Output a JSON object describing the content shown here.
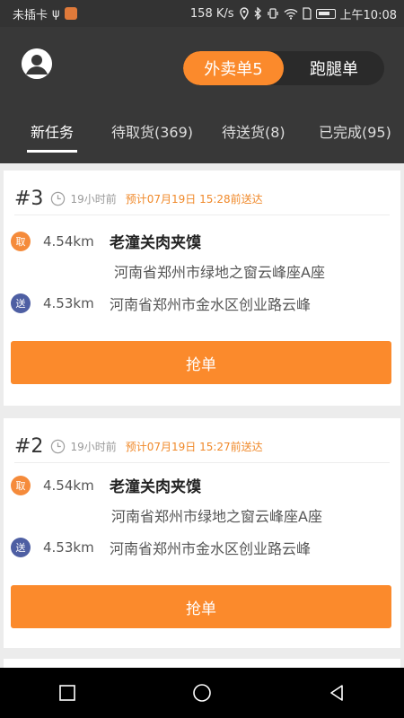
{
  "status_bar": {
    "carrier": "未插卡",
    "usb": "ψ",
    "speed": "158 K/s",
    "time": "上午10:08"
  },
  "header": {
    "segments": [
      {
        "label": "外卖单5",
        "active": true
      },
      {
        "label": "跑腿单",
        "active": false
      }
    ],
    "tabs": [
      {
        "label": "新任务",
        "active": true
      },
      {
        "label": "待取货(369)",
        "active": false
      },
      {
        "label": "待送货(8)",
        "active": false
      },
      {
        "label": "已完成(95)",
        "active": false
      }
    ]
  },
  "orders": [
    {
      "number": "#3",
      "ago": "19小时前",
      "eta": "预计07月19日 15:28前送达",
      "pickup": {
        "badge": "取",
        "distance": "4.54km",
        "shop": "老潼关肉夹馍",
        "address": "河南省郑州市绿地之窗云峰座A座"
      },
      "delivery": {
        "badge": "送",
        "distance": "4.53km",
        "address": "河南省郑州市金水区创业路云峰"
      },
      "button": "抢单"
    },
    {
      "number": "#2",
      "ago": "19小时前",
      "eta": "预计07月19日 15:27前送达",
      "pickup": {
        "badge": "取",
        "distance": "4.54km",
        "shop": "老潼关肉夹馍",
        "address": "河南省郑州市绿地之窗云峰座A座"
      },
      "delivery": {
        "badge": "送",
        "distance": "4.53km",
        "address": "河南省郑州市金水区创业路云峰"
      },
      "button": "抢单"
    }
  ],
  "colors": {
    "accent": "#fb8a2c",
    "header_bg": "#383838",
    "deliver_badge": "#4e5fa3"
  },
  "nav_icons": [
    "recent-apps-icon",
    "home-icon",
    "back-icon"
  ]
}
